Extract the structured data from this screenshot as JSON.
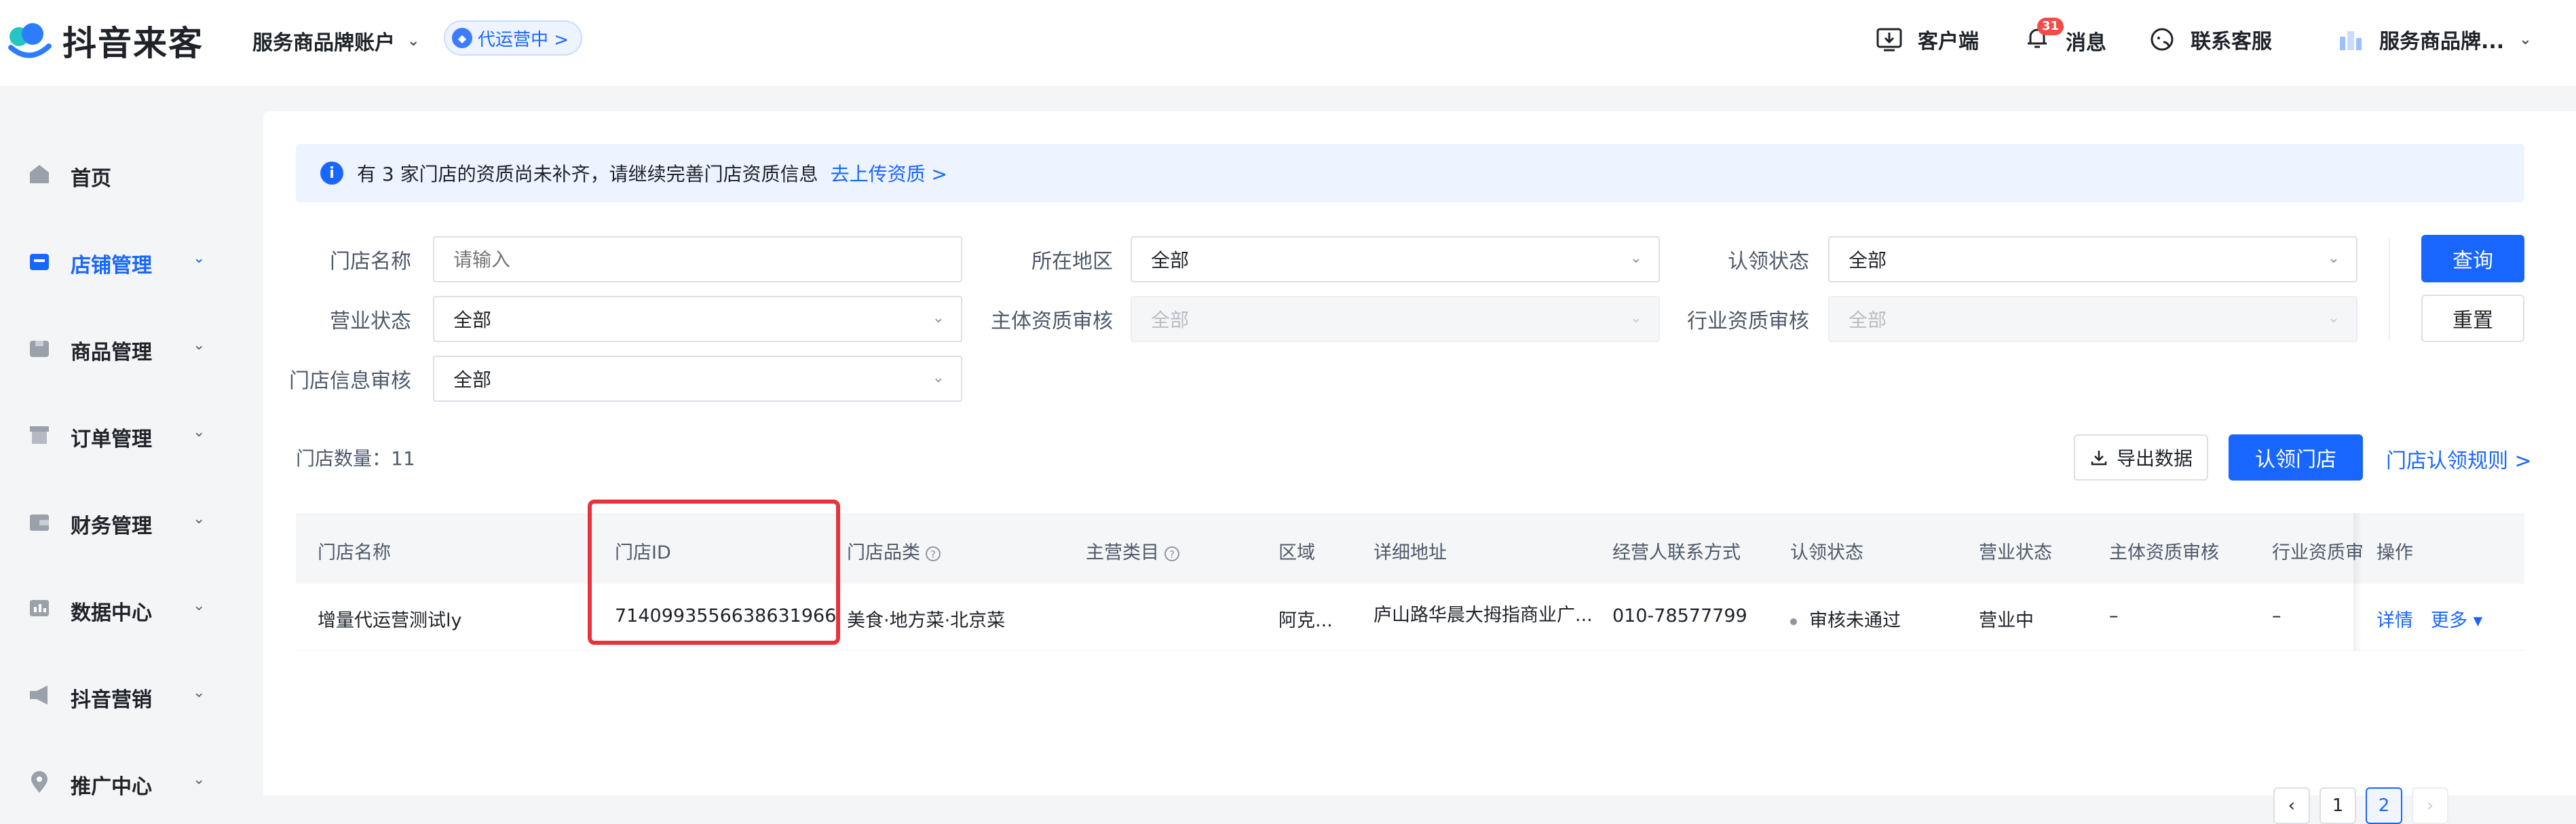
{
  "header": {
    "brand": "抖音来客",
    "account": "服务商品牌账户",
    "op_badge": "代运营中 >",
    "client": "客户端",
    "messages": "消息",
    "message_count": "31",
    "support": "联系客服",
    "user": "服务商品牌..."
  },
  "sidebar": {
    "items": [
      {
        "label": "首页"
      },
      {
        "label": "店铺管理"
      },
      {
        "label": "商品管理"
      },
      {
        "label": "订单管理"
      },
      {
        "label": "财务管理"
      },
      {
        "label": "数据中心"
      },
      {
        "label": "抖音营销"
      },
      {
        "label": "推广中心"
      }
    ]
  },
  "notice": {
    "text": "有 3 家门店的资质尚未补齐，请继续完善门店资质信息",
    "link": "去上传资质 >"
  },
  "filters": {
    "store_name_label": "门店名称",
    "store_name_placeholder": "请输入",
    "region_label": "所在地区",
    "region_value": "全部",
    "claim_label": "认领状态",
    "claim_value": "全部",
    "biz_label": "营业状态",
    "biz_value": "全部",
    "subject_label": "主体资质审核",
    "subject_value": "全部",
    "industry_label": "行业资质审核",
    "industry_value": "全部",
    "info_label": "门店信息审核",
    "info_value": "全部",
    "query": "查询",
    "reset": "重置"
  },
  "toolbar": {
    "count_label": "门店数量：11",
    "export": "导出数据",
    "claim": "认领门店",
    "rules": "门店认领规则 >"
  },
  "table": {
    "columns": [
      "门店名称",
      "门店ID",
      "门店品类",
      "主营类目",
      "区域",
      "详细地址",
      "经营人联系方式",
      "认领状态",
      "营业状态",
      "主体资质审核",
      "行业资质审",
      "操作"
    ],
    "rows": [
      {
        "name": "增量代运营测试ly",
        "id": "7140993556638631966",
        "category": "美食·地方菜·北京菜",
        "main_category": "",
        "region": "阿克...",
        "address": "庐山路华晨大拇指商业广...",
        "contact": "010-78577799",
        "claim_status": "审核未通过",
        "biz_status": "营业中",
        "subject_review": "–",
        "industry_review": "–",
        "detail": "详情",
        "more": "更多 ▾"
      }
    ]
  },
  "pagination": {
    "pages": [
      "1",
      "2"
    ],
    "current": "2",
    "prev": "‹",
    "next": "›"
  }
}
